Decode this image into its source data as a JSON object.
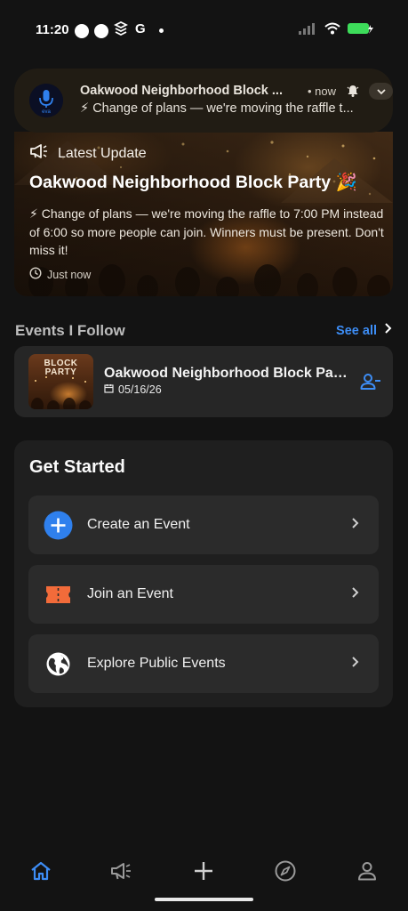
{
  "status_bar": {
    "time": "11:20",
    "app_icons": [
      "circle-icon",
      "circle-icon",
      "stack-icon",
      "G"
    ],
    "signal_icon": "signal-icon",
    "wifi_icon": "wifi-icon",
    "battery_icon": "battery-charging-icon",
    "battery_color": "#3ddc5a"
  },
  "notification": {
    "app_icon": "microphone-icon",
    "app_label": "eva",
    "title": "Oakwood Neighborhood Block ...",
    "time": "• now",
    "body": "⚡ Change of plans — we're moving the raffle t...",
    "bell_icon": "bell-icon",
    "expand_icon": "chevron-down-icon",
    "background": "#211c14"
  },
  "hero": {
    "badge_icon": "megaphone-icon",
    "badge_label": "Latest Update",
    "title": "Oakwood Neighborhood Block Party 🎉",
    "body": "⚡ Change of plans — we're moving the raffle to 7:00 PM instead of 6:00 so more people can join. Winners must be present. Don't miss it!",
    "time_icon": "clock-icon",
    "time": "Just now"
  },
  "events_follow": {
    "title": "Events I Follow",
    "see_all": "See all",
    "see_all_icon": "chevron-right-icon",
    "accent": "#3d8df5",
    "items": [
      {
        "thumb_text": "BLOCK PARTY",
        "name": "Oakwood Neighborhood Block Party 🎉",
        "date_icon": "calendar-icon",
        "date": "05/16/26",
        "action_icon": "person-remove-icon"
      }
    ]
  },
  "get_started": {
    "title": "Get Started",
    "items": [
      {
        "icon": "plus-circle-icon",
        "label": "Create an Event",
        "icon_color": "#2f80ed"
      },
      {
        "icon": "ticket-icon",
        "label": "Join an Event",
        "icon_color": "#f26b3a"
      },
      {
        "icon": "globe-icon",
        "label": "Explore Public Events",
        "icon_color": "#ffffff"
      }
    ]
  },
  "bottom_nav": {
    "items": [
      {
        "name": "Home",
        "icon": "home-icon",
        "active": true
      },
      {
        "name": "Updates",
        "icon": "megaphone-icon",
        "active": false
      },
      {
        "name": "Create",
        "icon": "plus-icon",
        "active": false
      },
      {
        "name": "Explore",
        "icon": "compass-icon",
        "active": false
      },
      {
        "name": "Profile",
        "icon": "person-icon",
        "active": false
      }
    ],
    "active_color": "#3d8df5",
    "inactive_color": "#9a9a9a"
  }
}
